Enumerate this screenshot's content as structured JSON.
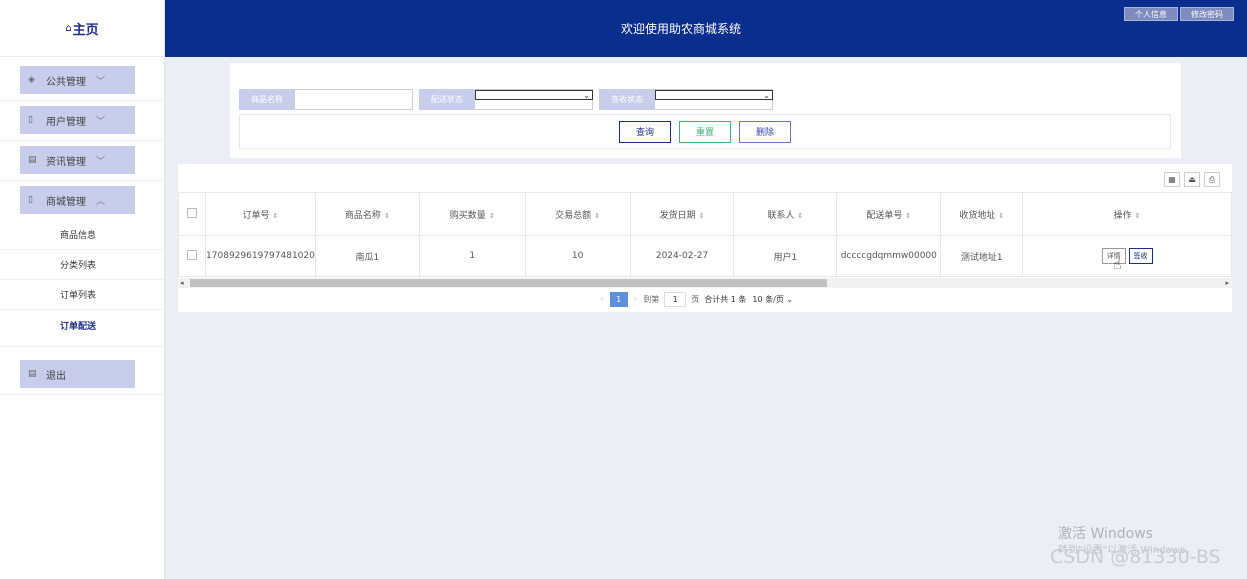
{
  "sidebar": {
    "logo": "主页",
    "groups": [
      {
        "label": "公共管理",
        "icon": "layers-icon",
        "chevron": "﹀"
      },
      {
        "label": "用户管理",
        "icon": "doc-icon",
        "chevron": "﹀"
      },
      {
        "label": "资讯管理",
        "icon": "list-icon",
        "chevron": "﹀"
      },
      {
        "label": "商城管理",
        "icon": "doc-icon",
        "chevron": "︿"
      },
      {
        "label": "退出",
        "icon": "list-icon"
      }
    ],
    "submenu": [
      "商品信息",
      "分类列表",
      "订单列表",
      "订单配送"
    ]
  },
  "header": {
    "title": "欢迎使用助农商城系统",
    "personal_info": "个人信息",
    "change_password": "修改密码"
  },
  "search": {
    "product_name_label": "商品名称",
    "delivery_status_label": "配送状态",
    "receipt_status_label": "签收状态",
    "query_button": "查询",
    "reset_button": "重置",
    "delete_button": "删除"
  },
  "table": {
    "columns": [
      "订单号",
      "商品名称",
      "购买数量",
      "交易总额",
      "发货日期",
      "联系人",
      "配送单号",
      "收货地址",
      "操作"
    ],
    "rows": [
      {
        "order_no": "1708929619797481020",
        "product": "南瓜1",
        "quantity": "1",
        "total": "10",
        "ship_date": "2024-02-27",
        "contact": "用户1",
        "tracking_no": "dccccgdqmmw00000",
        "address": "测试地址1",
        "detail_button": "详情",
        "sign_button": "签收"
      }
    ]
  },
  "pagination": {
    "current_page": "1",
    "goto_label": "到第",
    "goto_value": "1",
    "page_unit": "页",
    "total_text": "合计共 1 条",
    "page_size": "10 条/页"
  },
  "watermark": {
    "line1": "激活 Windows",
    "line2": "转到\"设置\"以激活 Windows。",
    "csdn": "CSDN @81330-BS"
  }
}
